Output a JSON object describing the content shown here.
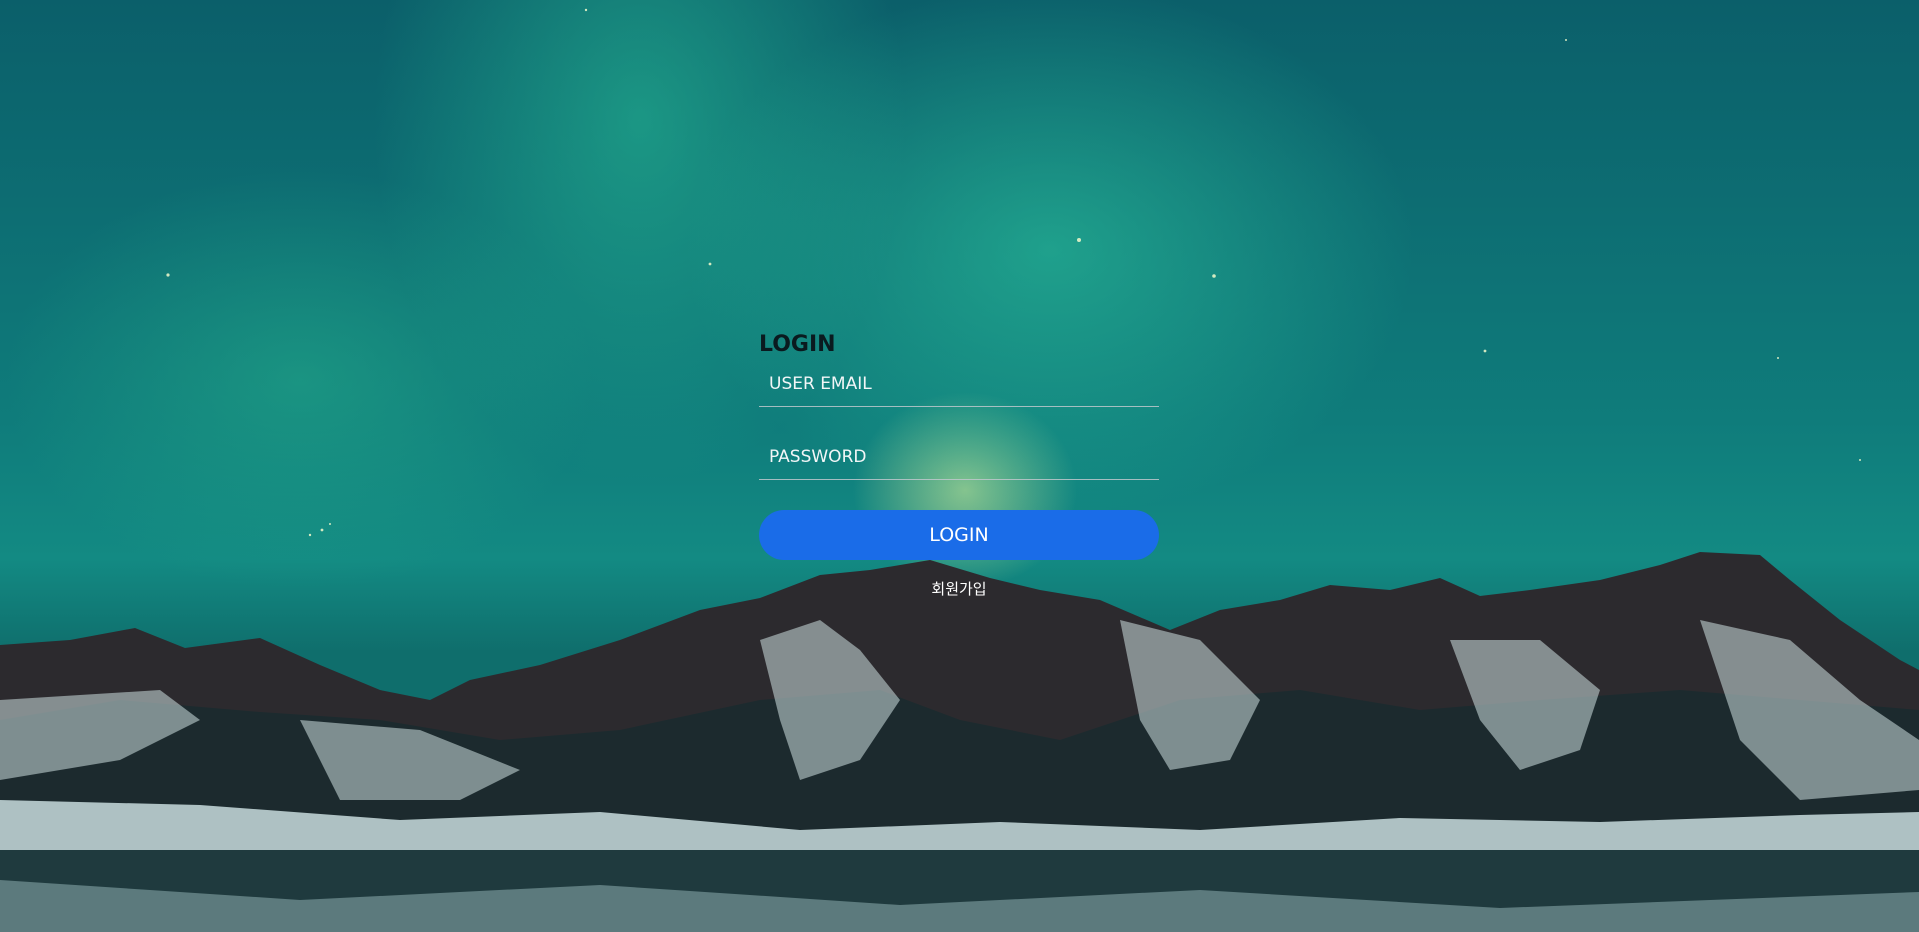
{
  "login": {
    "title": "LOGIN",
    "email_placeholder": "USER EMAIL",
    "password_placeholder": "PASSWORD",
    "submit_label": "LOGIN",
    "signup_label": "회원가입"
  },
  "colors": {
    "button": "#1a6ce8",
    "sky": "#0f7c7b",
    "aurora": "#2ec8a0"
  }
}
